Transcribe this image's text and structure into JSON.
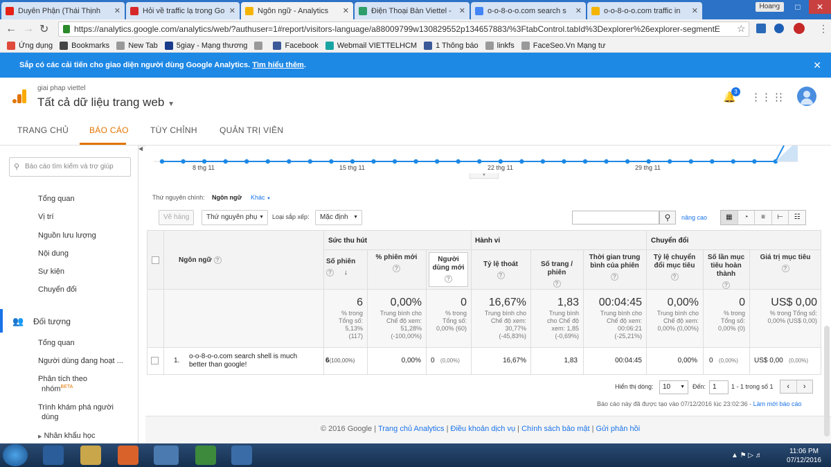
{
  "browser": {
    "tabs": [
      {
        "title": "Duyên Phận (Thái Thịnh",
        "color": "#e62117"
      },
      {
        "title": "Hỏi về traffic lạ trong Go",
        "color": "#d62828"
      },
      {
        "title": "Ngôn ngữ - Analytics",
        "color": "#f4b400"
      },
      {
        "title": "Điện Thoại Bàn Viettel -",
        "color": "#2e9e6a"
      },
      {
        "title": "o-o-8-o-o.com search s",
        "color": "#4285f4"
      },
      {
        "title": "o-o-8-o-o.com traffic in",
        "color": "#f4b400"
      }
    ],
    "user_chip": "Hoang",
    "url": "https://analytics.google.com/analytics/web/?authuser=1#report/visitors-language/a88009799w130829552p134657883/%3FtabControl.tabId%3Dexplorer%26explorer-segmentE",
    "bookmarks": [
      {
        "label": "Ứng dụng",
        "color": "#e04a3a"
      },
      {
        "label": "Bookmarks",
        "color": "#444444"
      },
      {
        "label": "New Tab",
        "color": "#999999"
      },
      {
        "label": "5giay - Mạng thương",
        "color": "#1a3a8a"
      },
      {
        "label": "",
        "color": "#999999"
      },
      {
        "label": "Facebook",
        "color": "#3b5998"
      },
      {
        "label": "Webmail VIETTELHCM",
        "color": "#1aa3a3"
      },
      {
        "label": "1 Thông báo",
        "color": "#3b5998"
      },
      {
        "label": "linkfs",
        "color": "#999999"
      },
      {
        "label": "FaceSeo.Vn Mạng tư",
        "color": "#999999"
      }
    ]
  },
  "notice": {
    "text": "Sắp có các cải tiến cho giao diện người dùng Google Analytics.",
    "link": "Tìm hiểu thêm",
    "dot": "."
  },
  "header": {
    "account_sub": "giai phap viettel",
    "account_main": "Tất cả dữ liệu trang web",
    "notif_count": "3"
  },
  "nav": [
    "TRANG CHỦ",
    "BÁO CÁO",
    "TÙY CHỈNH",
    "QUẢN TRỊ VIÊN"
  ],
  "sidebar": {
    "search_placeholder": "Báo cáo tìm kiếm và trợ giúp",
    "items_top": [
      "Tổng quan",
      "Vị trí",
      "Nguồn lưu lượng",
      "Nội dung",
      "Sự kiện",
      "Chuyển đổi"
    ],
    "section": "Đối tượng",
    "items_bottom": [
      "Tổng quan",
      "Người dùng đang hoạt ...",
      "Phân tích theo",
      "nhóm",
      "BETA",
      "Trình khám phá người",
      "dùng",
      "Nhân khẩu học"
    ]
  },
  "chart": {
    "x_labels": [
      "8 thg 11",
      "15 thg 11",
      "22 thg 11",
      "29 thg 11"
    ]
  },
  "dimension": {
    "label": "Thứ nguyên chính:",
    "primary": "Ngôn ngữ",
    "other": "Khác"
  },
  "controls": {
    "plot_rows": "Vẽ hàng",
    "secondary": "Thứ nguyên phụ",
    "sort_label": "Loại sắp xếp:",
    "sort_value": "Mặc định",
    "advanced": "nâng cao"
  },
  "table": {
    "groups": [
      "Sức thu hút",
      "Hành vi",
      "Chuyển đổi"
    ],
    "dim_header": "Ngôn ngữ",
    "columns": [
      "Số phiên",
      "% phiên mới",
      "Người dùng mới",
      "Tỷ lệ thoát",
      "Số trang / phiên",
      "Thời gian trung bình của phiên",
      "Tỷ lệ chuyển đổi mục tiêu",
      "Số lần mục tiêu hoàn thành",
      "Giá trị mục tiêu"
    ],
    "totals": [
      {
        "value": "6",
        "sub": [
          "% trong",
          "Tổng số:",
          "5,13%",
          "(117)"
        ]
      },
      {
        "value": "0,00%",
        "sub": [
          "Trung bình cho",
          "Chế độ xem:",
          "51,28%",
          "(-100,00%)"
        ]
      },
      {
        "value": "0",
        "sub": [
          "% trong",
          "Tổng số:",
          "0,00% (60)"
        ]
      },
      {
        "value": "16,67%",
        "sub": [
          "Trung bình cho",
          "Chế độ xem:",
          "30,77%",
          "(-45,83%)"
        ]
      },
      {
        "value": "1,83",
        "sub": [
          "Trung bình",
          "cho Chế độ",
          "xem: 1,85",
          "(-0,69%)"
        ]
      },
      {
        "value": "00:04:45",
        "sub": [
          "Trung bình cho",
          "Chế độ xem:",
          "00:06:21",
          "(-25,21%)"
        ]
      },
      {
        "value": "0,00%",
        "sub": [
          "Trung bình cho",
          "Chế độ xem:",
          "0,00% (0,00%)"
        ]
      },
      {
        "value": "0",
        "sub": [
          "% trong",
          "Tổng số:",
          "0,00% (0)"
        ]
      },
      {
        "value": "US$ 0,00",
        "sub": [
          "% trong Tổng số:",
          "0,00% (US$ 0,00)"
        ]
      }
    ],
    "row": {
      "index": "1.",
      "language": [
        "o-o-8-o-o.com search shell is much",
        "better than google!"
      ],
      "sessions": "6",
      "sessions_pct": "(100,00%)",
      "new_pct": "0,00%",
      "new_users": "0",
      "new_users_pct": "(0,00%)",
      "bounce": "16,67%",
      "pages": "1,83",
      "duration": "00:04:45",
      "conv_rate": "0,00%",
      "goals": "0",
      "goals_pct": "(0,00%)",
      "goal_value": "US$ 0,00",
      "goal_value_pct": "(0,00%)"
    }
  },
  "pagination": {
    "show_rows": "Hiển thị dòng:",
    "rows_value": "10",
    "goto": "Đến:",
    "goto_value": "1",
    "range": "1 - 1 trong số 1"
  },
  "report_note": {
    "text": "Báo cáo này đã được tạo vào 07/12/2016 lúc 23:02:36 - ",
    "link": "Làm mới báo cáo"
  },
  "footer": [
    "© 2016 Google",
    "Trang chủ Analytics",
    "Điều khoản dịch vụ",
    "Chính sách bảo mật",
    "Gửi phản hồi"
  ],
  "taskbar": {
    "time": "11:06 PM",
    "date": "07/12/2016"
  }
}
